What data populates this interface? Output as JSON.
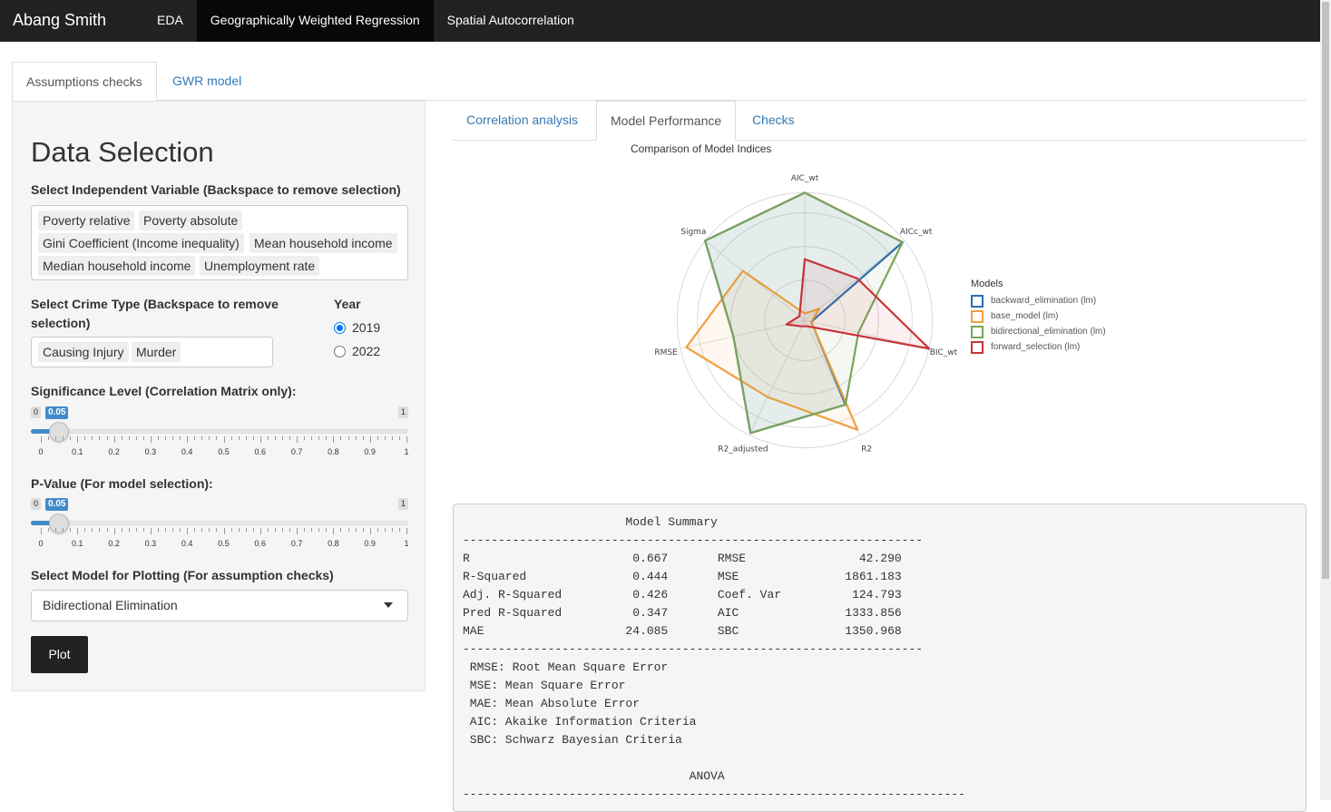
{
  "navbar": {
    "brand": "Abang Smith",
    "items": [
      {
        "label": "EDA",
        "active": false
      },
      {
        "label": "Geographically Weighted Regression",
        "active": true
      },
      {
        "label": "Spatial Autocorrelation",
        "active": false
      }
    ]
  },
  "outer_tabs": [
    {
      "label": "Assumptions checks",
      "active": true
    },
    {
      "label": "GWR model",
      "active": false
    }
  ],
  "sidebar": {
    "heading": "Data Selection",
    "indep_label": "Select Independent Variable (Backspace to remove selection)",
    "indep_selected": [
      "Poverty relative",
      "Poverty absolute",
      "Gini Coefficient (Income inequality)",
      "Mean household income",
      "Median household income",
      "Unemployment rate"
    ],
    "crime_label_1": "Select Crime Type (Backspace to remove",
    "crime_label_2": "selection)",
    "crime_selected": [
      "Causing Injury",
      "Murder"
    ],
    "year_label": "Year",
    "year_options": [
      {
        "label": "2019",
        "checked": true
      },
      {
        "label": "2022",
        "checked": false
      }
    ],
    "sig_label": "Significance Level (Correlation Matrix only):",
    "sig_slider": {
      "min": "0",
      "max": "1",
      "value": "0.05",
      "fraction": 0.05
    },
    "p_label": "P-Value (For model selection):",
    "p_slider": {
      "min": "0",
      "max": "1",
      "value": "0.05",
      "fraction": 0.05
    },
    "slider_ticks": [
      "0",
      "0.1",
      "0.2",
      "0.3",
      "0.4",
      "0.5",
      "0.6",
      "0.7",
      "0.8",
      "0.9",
      "1"
    ],
    "model_label": "Select Model for Plotting (For assumption checks)",
    "model_selected": "Bidirectional Elimination",
    "plot_button": "Plot"
  },
  "inner_tabs": [
    {
      "label": "Correlation analysis",
      "active": false
    },
    {
      "label": "Model Performance",
      "active": true
    },
    {
      "label": "Checks",
      "active": false
    }
  ],
  "chart_data": {
    "type": "radar",
    "title": "Comparison of Model Indices",
    "axes": [
      "Sigma",
      "AIC_wt",
      "AICc_wt",
      "BIC_wt",
      "R2",
      "R2_adjusted",
      "RMSE"
    ],
    "range": [
      0,
      1
    ],
    "legend_title": "Models",
    "legend_position": "right",
    "series": [
      {
        "name": "backward_elimination (lm)",
        "color": "#2b6cb0",
        "values": [
          1.0,
          1.0,
          0.98,
          0.0,
          0.72,
          0.98,
          0.55
        ]
      },
      {
        "name": "base_model (lm)",
        "color": "#f0a040",
        "values": [
          0.6,
          0.0,
          0.1,
          0.0,
          0.95,
          0.65,
          0.95
        ]
      },
      {
        "name": "bidirectional_elimination (lm)",
        "color": "#7ca45a",
        "values": [
          1.0,
          1.0,
          0.98,
          0.4,
          0.72,
          0.98,
          0.55
        ]
      },
      {
        "name": "forward_selection (lm)",
        "color": "#c8323a",
        "values": [
          0.0,
          0.45,
          0.5,
          1.0,
          0.0,
          0.0,
          0.1
        ]
      }
    ]
  },
  "summary": {
    "lines": [
      "                       Model Summary",
      "-----------------------------------------------------------------",
      "R                       0.667       RMSE                42.290",
      "R-Squared               0.444       MSE               1861.183",
      "Adj. R-Squared          0.426       Coef. Var          124.793",
      "Pred R-Squared          0.347       AIC               1333.856",
      "MAE                    24.085       SBC               1350.968",
      "-----------------------------------------------------------------",
      " RMSE: Root Mean Square Error",
      " MSE: Mean Square Error",
      " MAE: Mean Absolute Error",
      " AIC: Akaike Information Criteria",
      " SBC: Schwarz Bayesian Criteria",
      "",
      "                                ANOVA",
      "-----------------------------------------------------------------------"
    ]
  }
}
